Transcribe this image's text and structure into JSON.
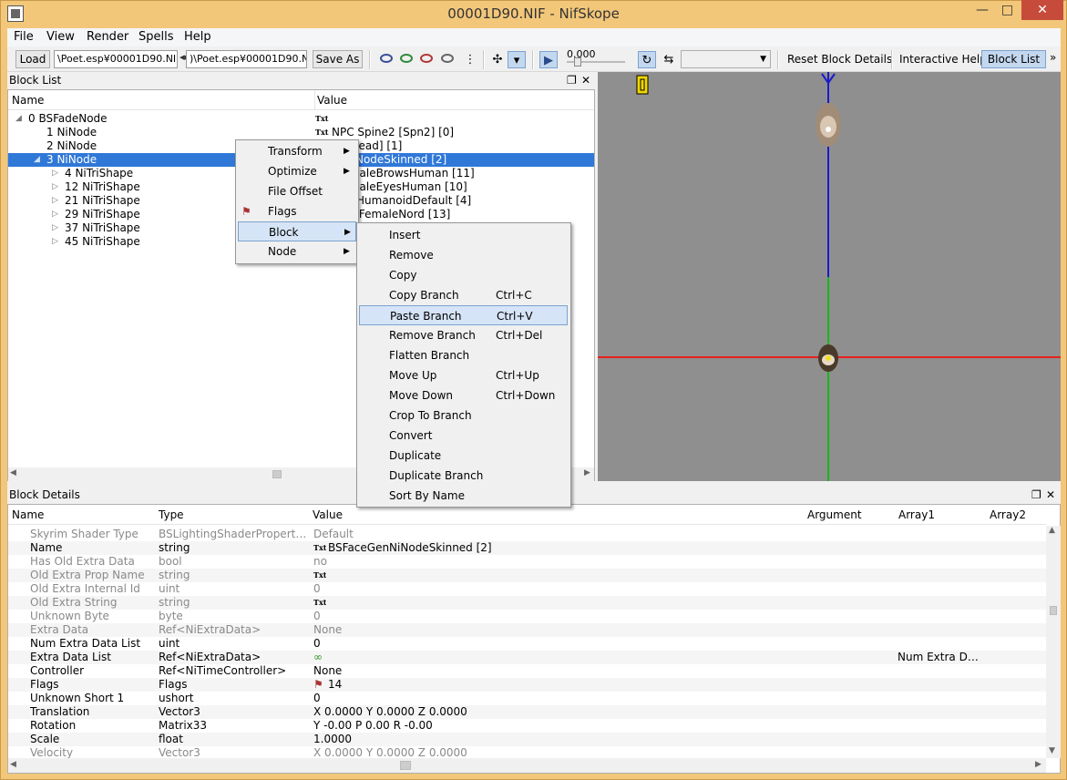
{
  "window": {
    "title": "00001D90.NIF - NifSkope",
    "min": "—",
    "max": "□",
    "close": "✕"
  },
  "menubar": [
    "File",
    "View",
    "Render",
    "Spells",
    "Help"
  ],
  "toolbar": {
    "load": "Load",
    "load_path": "\\Poet.esp¥00001D90.NIF",
    "save_path": ")\\Poet.esp¥00001D90.NIF",
    "save_as": "Save As",
    "time_value": "0.000",
    "reset_block_details": "Reset Block Details",
    "interactive_help": "Interactive Help",
    "block_list": "Block List",
    "more": "»"
  },
  "block_list": {
    "title": "Block List",
    "columns": [
      "Name",
      "Value"
    ],
    "rows": [
      {
        "indent": 0,
        "expander": "◢",
        "name": "0 BSFadeNode",
        "value": "",
        "badge": "Txt"
      },
      {
        "indent": 1,
        "expander": "",
        "name": "1 NiNode",
        "value": "NPC Spine2 [Spn2] [0]",
        "badge": "Txt"
      },
      {
        "indent": 1,
        "expander": "",
        "name": "2 NiNode",
        "value": "head [Head] [1]",
        "badge": ""
      },
      {
        "indent": 1,
        "expander": "◢",
        "name": "3 NiNode",
        "value": "eGenNiNodeSkinned [2]",
        "badge": "",
        "selected": true
      },
      {
        "indent": 2,
        "expander": "▷",
        "name": "4 NiTriShape",
        "value": "hiraFemaleBrowsHuman [11]",
        "badge": ""
      },
      {
        "indent": 2,
        "expander": "▷",
        "name": "12 NiTriShape",
        "value": "hiraFemaleEyesHuman [10]",
        "badge": ""
      },
      {
        "indent": 2,
        "expander": "▷",
        "name": "21 NiTriShape",
        "value": "eMouthHumanoidDefault [4]",
        "badge": ""
      },
      {
        "indent": 2,
        "expander": "▷",
        "name": "29 NiTriShape",
        "value": "hiraHairFemaleNord [13]",
        "badge": ""
      },
      {
        "indent": 2,
        "expander": "▷",
        "name": "37 NiTriShape",
        "value": "",
        "badge": ""
      },
      {
        "indent": 2,
        "expander": "▷",
        "name": "45 NiTriShape",
        "value": "",
        "badge": ""
      }
    ]
  },
  "context_menu": {
    "items": [
      {
        "label": "Transform",
        "submenu": true
      },
      {
        "label": "Optimize",
        "submenu": true
      },
      {
        "label": "File Offset",
        "submenu": false
      },
      {
        "label": "Flags",
        "submenu": false
      },
      {
        "label": "Block",
        "submenu": true,
        "highlighted": true
      },
      {
        "label": "Node",
        "submenu": true
      }
    ]
  },
  "block_submenu": {
    "items": [
      {
        "label": "Insert",
        "shortcut": ""
      },
      {
        "label": "Remove",
        "shortcut": ""
      },
      {
        "label": "Copy",
        "shortcut": ""
      },
      {
        "label": "Copy Branch",
        "shortcut": "Ctrl+C"
      },
      {
        "label": "Paste Branch",
        "shortcut": "Ctrl+V",
        "highlighted": true
      },
      {
        "label": "Remove Branch",
        "shortcut": "Ctrl+Del"
      },
      {
        "label": "Flatten Branch",
        "shortcut": ""
      },
      {
        "label": "Move Up",
        "shortcut": "Ctrl+Up"
      },
      {
        "label": "Move Down",
        "shortcut": "Ctrl+Down"
      },
      {
        "label": "Crop To Branch",
        "shortcut": ""
      },
      {
        "label": "Convert",
        "shortcut": ""
      },
      {
        "label": "Duplicate",
        "shortcut": ""
      },
      {
        "label": "Duplicate Branch",
        "shortcut": ""
      },
      {
        "label": "Sort By Name",
        "shortcut": ""
      }
    ]
  },
  "block_details": {
    "title": "Block Details",
    "columns": [
      "Name",
      "Type",
      "Value",
      "Argument",
      "Array1",
      "Array2"
    ],
    "rows": [
      {
        "name": "Skyrim Shader Type",
        "type": "BSLightingShaderPropert…",
        "value": "Default",
        "arg": "",
        "arr1": "",
        "gray": true
      },
      {
        "name": "Name",
        "type": "string",
        "value": "BSFaceGenNiNodeSkinned [2]",
        "badge": "Txt",
        "arr1": "",
        "gray": false
      },
      {
        "name": "Has Old Extra Data",
        "type": "bool",
        "value": "no",
        "arr1": "",
        "gray": true
      },
      {
        "name": "Old Extra Prop Name",
        "type": "string",
        "value": "",
        "badge": "Txt",
        "arr1": "",
        "gray": true
      },
      {
        "name": "Old Extra Internal Id",
        "type": "uint",
        "value": "0",
        "arr1": "",
        "gray": true
      },
      {
        "name": "Old Extra String",
        "type": "string",
        "value": "",
        "badge": "Txt",
        "arr1": "",
        "gray": true
      },
      {
        "name": "Unknown Byte",
        "type": "byte",
        "value": "0",
        "arr1": "",
        "gray": true
      },
      {
        "name": "Extra Data",
        "type": "Ref<NiExtraData>",
        "value": "None",
        "arr1": "",
        "gray": true
      },
      {
        "name": "Num Extra Data List",
        "type": "uint",
        "value": "0",
        "arr1": "",
        "gray": false
      },
      {
        "name": "Extra Data List",
        "type": "Ref<NiExtraData>",
        "value": "",
        "arr1": "Num Extra D…",
        "gray": false,
        "link_icon": true
      },
      {
        "name": "Controller",
        "type": "Ref<NiTimeController>",
        "value": "None",
        "arr1": "",
        "gray": false
      },
      {
        "name": "Flags",
        "type": "Flags",
        "value": "14",
        "arr1": "",
        "gray": false,
        "flag_icon": true
      },
      {
        "name": "Unknown Short 1",
        "type": "ushort",
        "value": "0",
        "arr1": "",
        "gray": false
      },
      {
        "name": "Translation",
        "type": "Vector3",
        "value": "X 0.0000 Y 0.0000 Z 0.0000",
        "arr1": "",
        "gray": false
      },
      {
        "name": "Rotation",
        "type": "Matrix33",
        "value": "Y -0.00 P 0.00 R -0.00",
        "arr1": "",
        "gray": false
      },
      {
        "name": "Scale",
        "type": "float",
        "value": "1.0000",
        "arr1": "",
        "gray": false
      },
      {
        "name": "Velocity",
        "type": "Vector3",
        "value": "X 0.0000 Y 0.0000 Z 0.0000",
        "arr1": "",
        "gray": true
      }
    ]
  },
  "icons": {
    "dock_float": "❐",
    "dock_close": "✕",
    "submenu_arrow": "▶"
  }
}
